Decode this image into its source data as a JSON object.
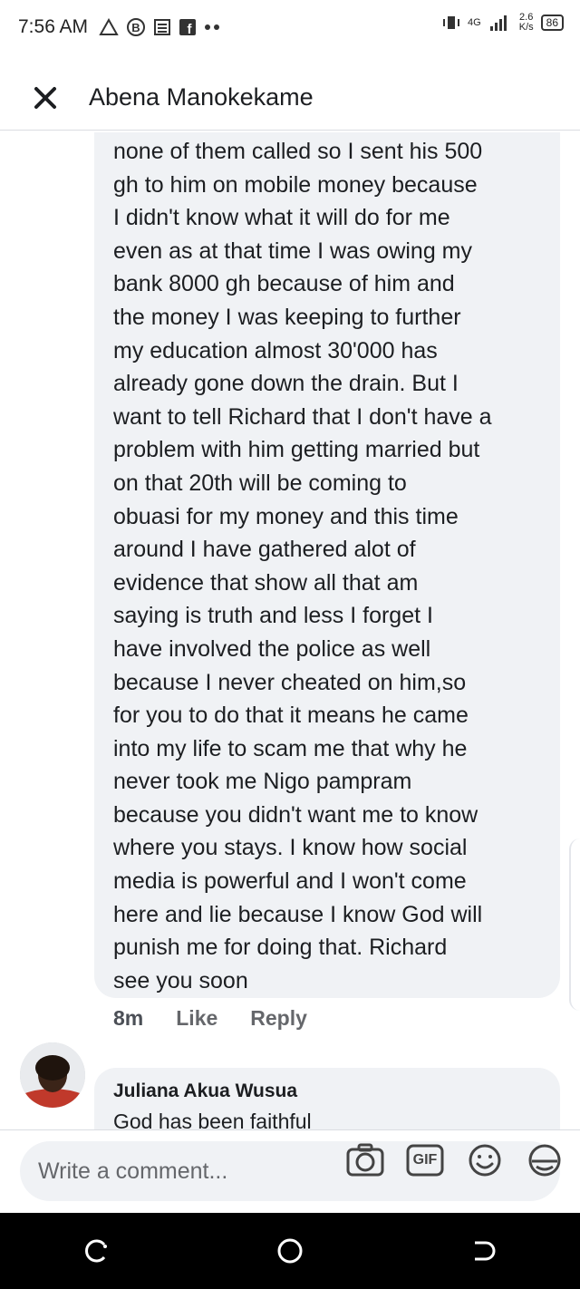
{
  "status_bar": {
    "time": "7:56 AM",
    "icons_left": [
      "alert-triangle-icon",
      "b-icon",
      "news-icon",
      "facebook-icon",
      "more-dots-icon"
    ],
    "network": "4G",
    "speed_value": "2.6",
    "speed_unit": "K/s",
    "battery": "86"
  },
  "header": {
    "title": "Abena Manokekame"
  },
  "comment": {
    "text": "none of them called so I sent his 500\ngh to him on mobile money because\nI didn't know what it will do for me\neven as at that time I was owing my\nbank 8000 gh because of him and\nthe money I was keeping to further\nmy education almost 30'000 has\nalready gone down the drain. But I\nwant to tell Richard that I don't have a\nproblem with him getting married but\non that 20th will be coming  to\nobuasi for my money and this time\naround I have gathered alot of\nevidence that show all that am\nsaying is truth and less I forget  I\nhave involved the police as well\nbecause I never cheated on him,so\nfor you to do that it means he came\ninto my life to scam me that why he\nnever took me Nigo pampram\nbecause you didn't want me to know\nwhere you stays. I know how social\nmedia is powerful and I won't come\nhere and lie because I know God will\npunish me for doing that. Richard\nsee you soon",
    "time": "8m",
    "like_label": "Like",
    "reply_label": "Reply"
  },
  "next_comment": {
    "author": "Juliana Akua Wusua",
    "text": "God has been faithful"
  },
  "composer": {
    "placeholder": "Write a comment...",
    "gif_label": "GIF"
  }
}
